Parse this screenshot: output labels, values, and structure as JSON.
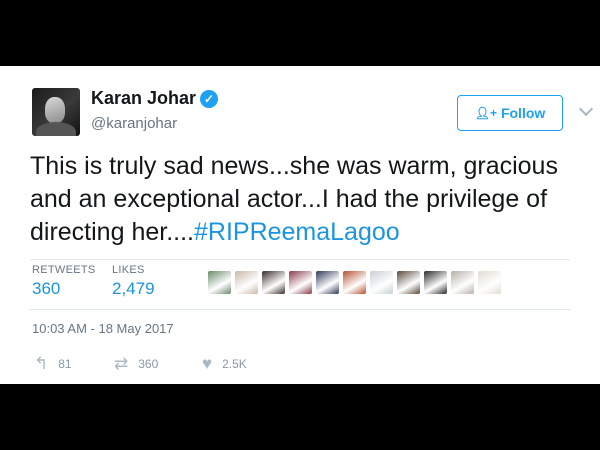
{
  "author": {
    "name": "Karan Johar",
    "handle": "@karanjohar",
    "verified_glyph": "✓"
  },
  "follow_button": {
    "icon": "person-add-icon",
    "label": "Follow"
  },
  "tweet": {
    "text": "This is truly sad news...she was warm, gracious and an exceptional actor...I had the privilege of directing her....",
    "hashtag": "#RIPReemaLagoo"
  },
  "stats": {
    "retweets_label": "RETWEETS",
    "retweets_value": "360",
    "likes_label": "LIKES",
    "likes_value": "2,479"
  },
  "likers": [
    {
      "color": "#6b8a6a"
    },
    {
      "color": "#c9b9a8"
    },
    {
      "color": "#3b2f2a"
    },
    {
      "color": "#8a3b4a"
    },
    {
      "color": "#2f3a5a"
    },
    {
      "color": "#b5532f"
    },
    {
      "color": "#c8d0d6"
    },
    {
      "color": "#5a4a3a"
    },
    {
      "color": "#2a2a2a"
    },
    {
      "color": "#b8b0a6"
    },
    {
      "color": "#e2ddd2"
    }
  ],
  "timestamp": "10:03 AM - 18 May 2017",
  "actions": {
    "reply": {
      "icon": "reply-icon",
      "count": "81"
    },
    "retweet": {
      "icon": "retweet-icon",
      "count": "360"
    },
    "like": {
      "icon": "heart-icon",
      "count": "2.5K"
    }
  },
  "colors": {
    "accent": "#1da1f2",
    "link": "#1b95e0",
    "secondary_text": "#657786",
    "frame": "#000000"
  }
}
